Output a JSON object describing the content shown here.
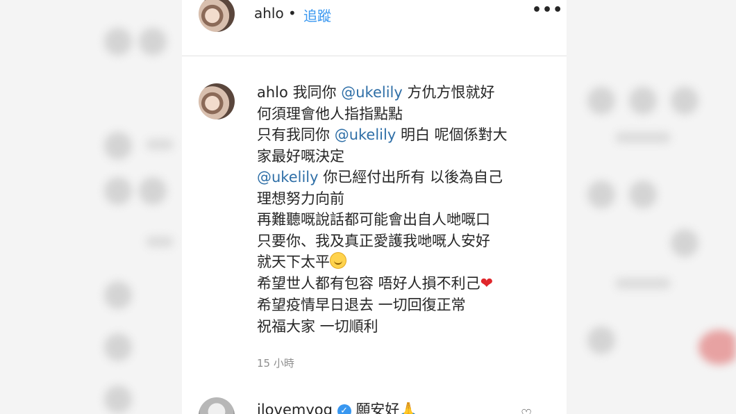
{
  "header": {
    "username": "ahlo",
    "separator": "•",
    "follow_label": "追蹤",
    "more_icon": "more-options-icon",
    "more_glyph": "•••"
  },
  "comment": {
    "username": "ahlo",
    "lines": {
      "l1_text_a": "我同你",
      "l1_mention": "@ukelily",
      "l1_text_b": "方仇方恨就好",
      "l2": "何須理會他人指指點點",
      "l3_text_a": "只有我同你",
      "l3_mention": "@ukelily",
      "l3_text_b": "明白 呢個係對大",
      "l4": "家最好嘅決定",
      "l5_mention": "@ukelily",
      "l5_text": "你已經付出所有 以後為自己",
      "l6": "理想努力向前",
      "l7": "再難聽嘅說話都可能會出自人哋嘅口",
      "l8": "只要你、我及真正愛護我哋嘅人安好",
      "l9": "就天下太平",
      "l10": "希望世人都有包容 唔好人損不利己",
      "l11": "希望疫情早日退去 一切回復正常",
      "l12": "祝福大家 一切順利"
    },
    "emojis": {
      "smile": "smiling-face-icon",
      "heart": "red-heart-icon",
      "heart_glyph": "❤"
    },
    "timestamp": "15 小時"
  },
  "reply": {
    "username": "ilovemyog",
    "verified_glyph": "✓",
    "text": "願安好",
    "pray_glyph": "🙏",
    "like_glyph": "♡"
  }
}
